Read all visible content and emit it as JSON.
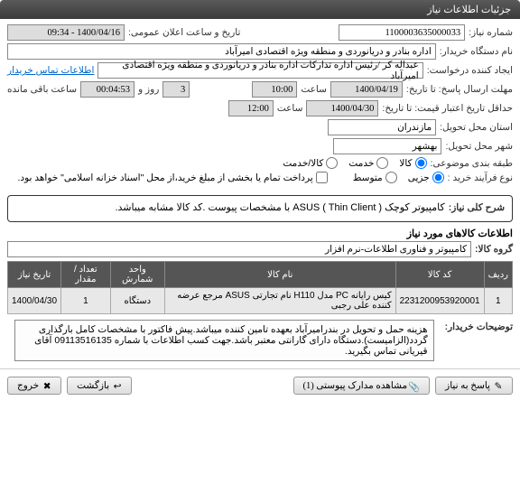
{
  "tab": {
    "title": "جزئیات اطلاعات نیاز"
  },
  "form": {
    "need_no_label": "شماره نیاز:",
    "need_no": "1100003635000033",
    "announce_label": "تاریخ و ساعت اعلان عمومی:",
    "announce": "1400/04/16 - 09:34",
    "buyer_label": "نام دستگاه خریدار:",
    "buyer": "اداره بنادر و دریانوردی و منطقه ویژه اقتصادی امیرآباد",
    "requester_label": "ایجاد کننده درخواست:",
    "requester": "عبداله کر /رئیس اداره تدارکات اداره بنادر و دریانوردی و منطقه ویژه اقتصادی امیرآباد",
    "contact_link": "اطلاعات تماس خریدار",
    "deadline_label": "مهلت ارسال پاسخ: تا تاریخ:",
    "deadline_date": "1400/04/19",
    "time_label": "ساعت",
    "deadline_time": "10:00",
    "days_remain": "3",
    "days_and": "روز و",
    "time_remain": "00:04:53",
    "remain_suffix": "ساعت باقی مانده",
    "validity_label": "حداقل تاریخ اعتبار قیمت: تا تاریخ:",
    "validity_date": "1400/04/30",
    "validity_time": "12:00",
    "province_label": "استان محل تحویل:",
    "province": "مازندران",
    "city_label": "شهر محل تحویل:",
    "city": "بهشهر",
    "category_label": "طبقه بندی موضوعی:",
    "cat_goods": "کالا",
    "cat_service": "خدمت",
    "cat_both": "کالا/خدمت",
    "process_label": "نوع فرآیند خرید :",
    "proc_mid": "متوسط",
    "proc_small": "جزیی",
    "payment_note": "پرداخت تمام یا بخشی از مبلغ خرید،از محل \"اسناد خزانه اسلامی\" خواهد بود.",
    "summary_label": "شرح کلی نیاز:",
    "summary": "کامپیوتر کوچک ASUS ( Thin Client ) با مشخصات پیوست .کد کالا مشابه میباشد.",
    "goods_section": "اطلاعات کالاهای مورد نیاز",
    "group_label": "گروه کالا:",
    "group": "کامپیوتر و فناوری اطلاعات-نرم افزار",
    "table": {
      "h_row": "ردیف",
      "h_code": "کد کالا",
      "h_name": "نام کالا",
      "h_unit": "واحد شمارش",
      "h_qty": "تعداد / مقدار",
      "h_date": "تاریخ نیاز",
      "rows": [
        {
          "idx": "1",
          "code": "2231200953920001",
          "name": "کیس رایانه PC مدل H110 نام تجارتی ASUS مرجع عرضه کننده علی رجبی",
          "unit": "دستگاه",
          "qty": "1",
          "date": "1400/04/30"
        }
      ]
    },
    "buyer_notes_label": "توضیحات خریدار:",
    "buyer_notes": "هزینه حمل و تحویل در بندرامیرآباد بعهده تامین کننده میباشد.پیش فاکتور با مشخصات کامل بارگذاری گردد(الزامیست).دستگاه دارای گارانتی معتبر باشد.جهت کسب اطلاعات با شماره 09113516135 آقای قیریانی تماس بگیرید."
  },
  "buttons": {
    "reply": "پاسخ به نیاز",
    "attachments": "مشاهده مدارک پیوستی (1)",
    "back": "بازگشت",
    "exit": "خروج"
  }
}
